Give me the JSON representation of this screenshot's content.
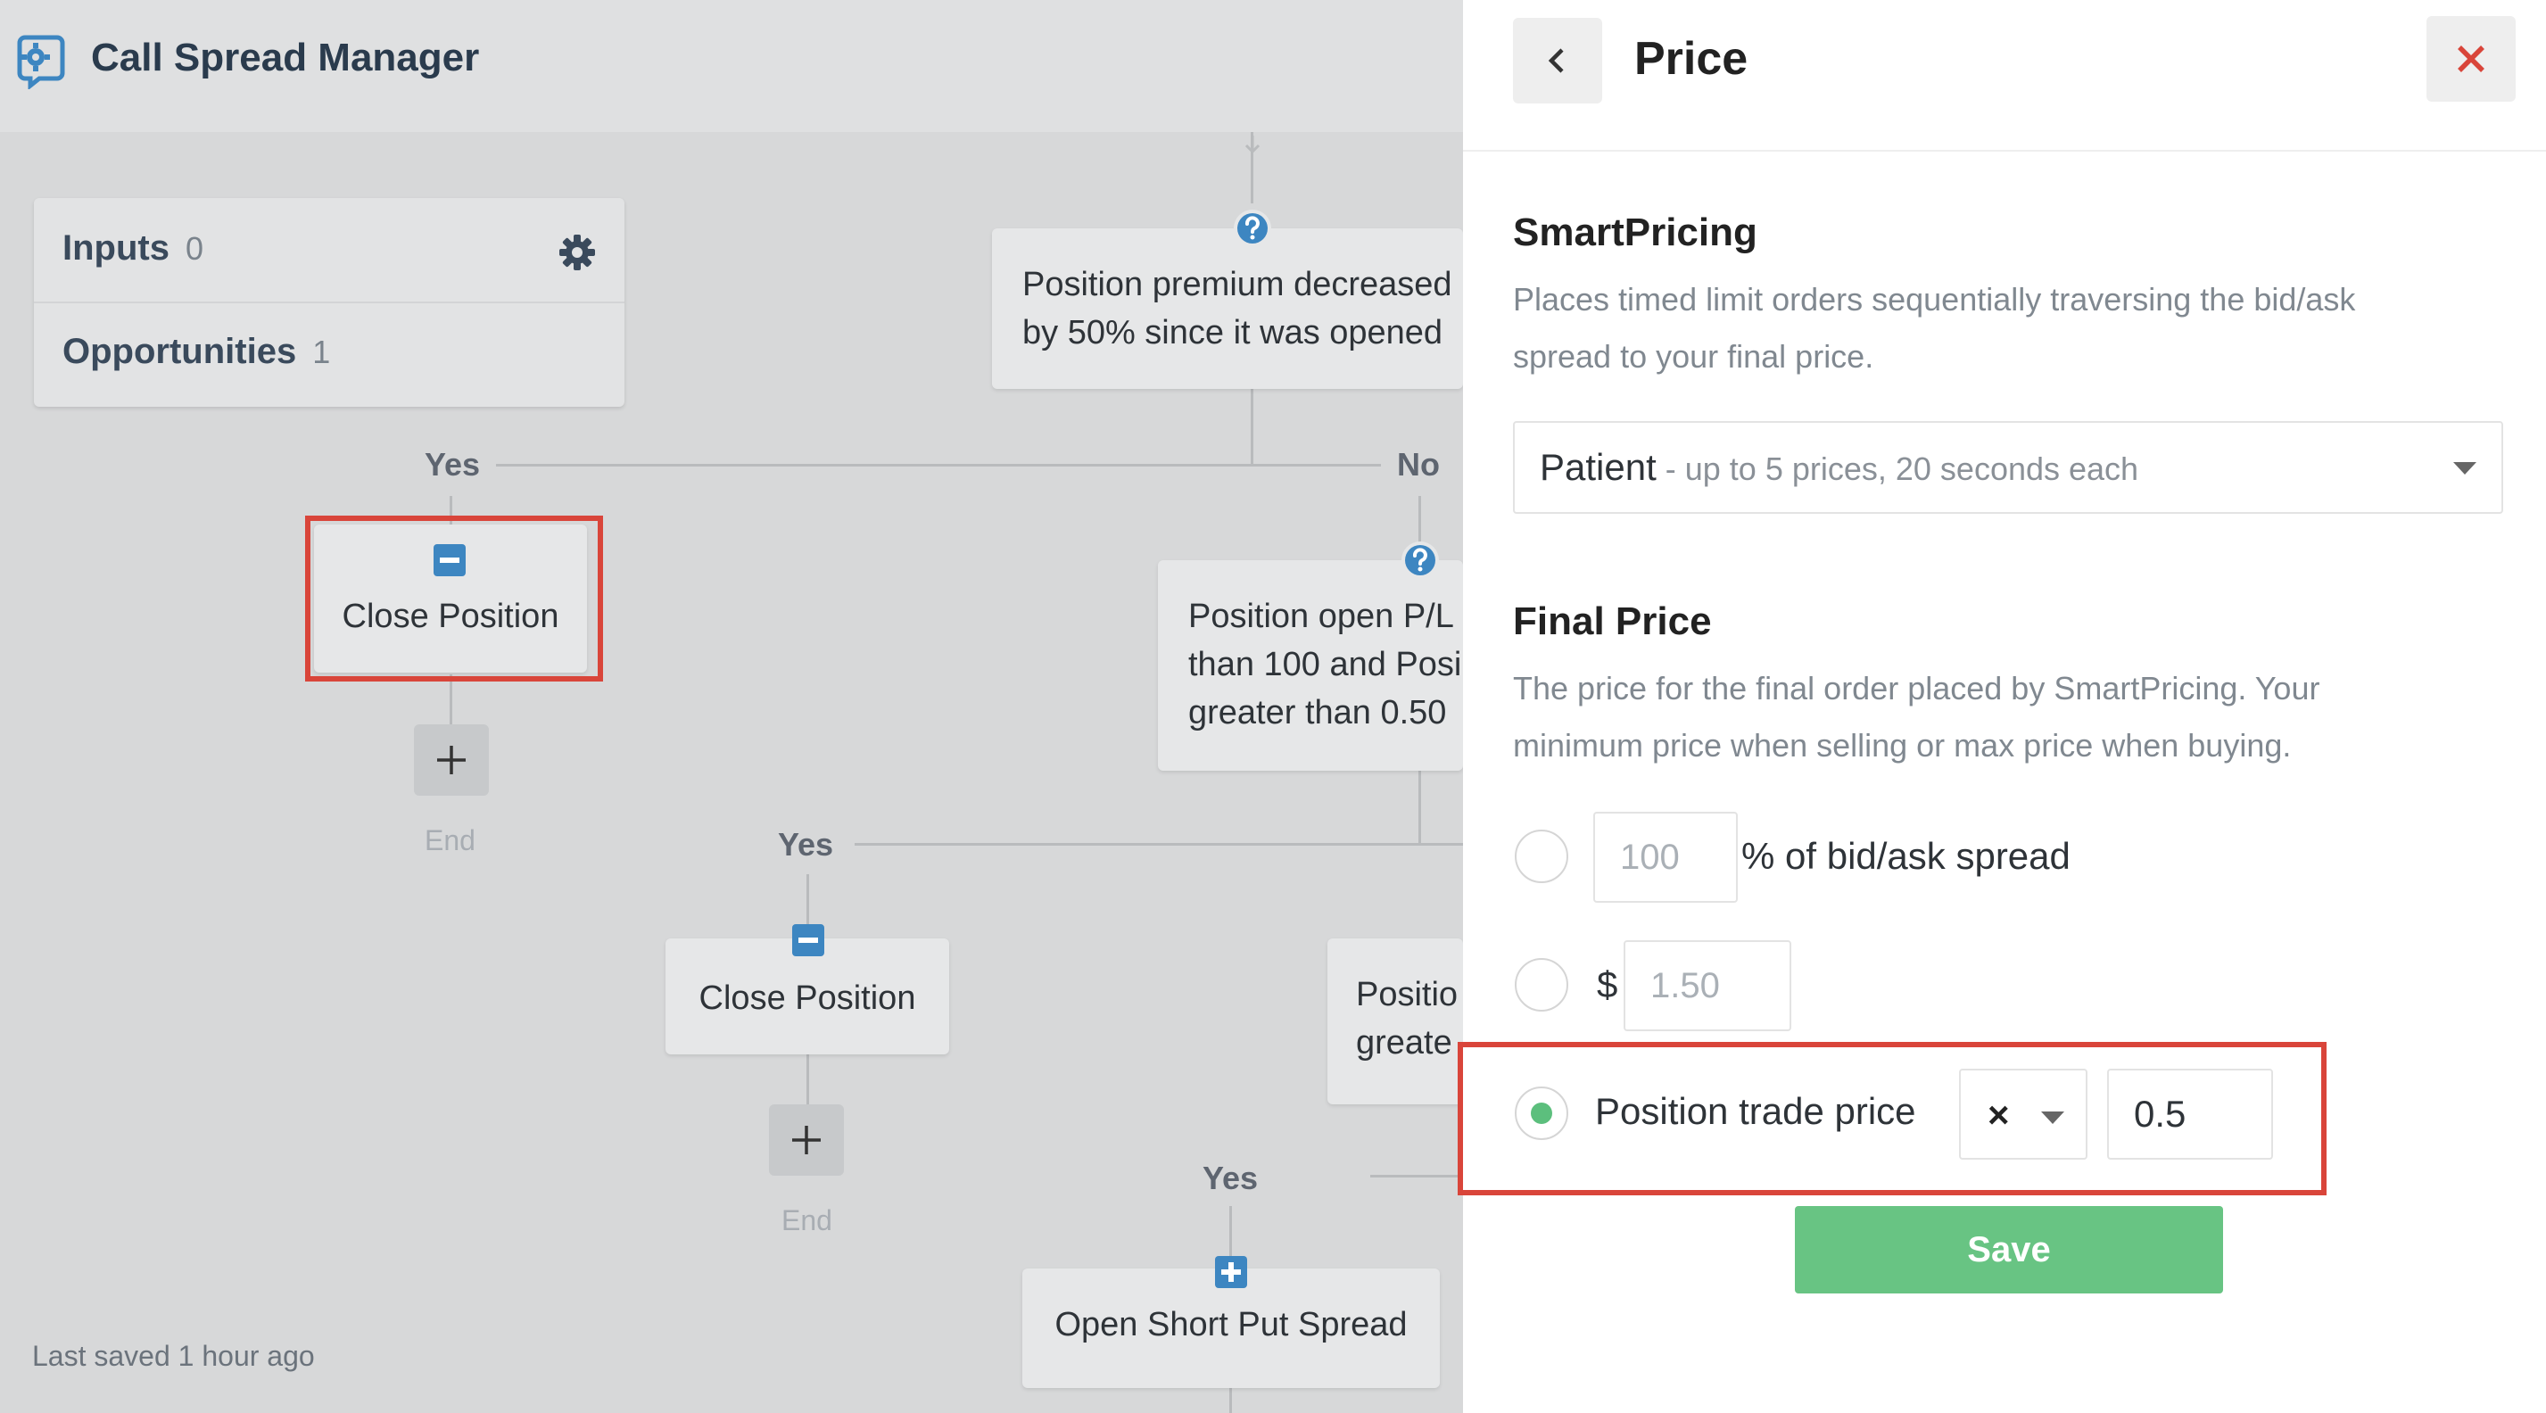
{
  "app": {
    "title": "Call Spread Manager",
    "last_saved": "Last saved 1 hour ago"
  },
  "sidebar": {
    "inputs_label": "Inputs",
    "inputs_count": "0",
    "opportunities_label": "Opportunities",
    "opportunities_count": "1"
  },
  "flow": {
    "condition_1": "Position premium decreased\nby 50% since it was opened",
    "yes_label": "Yes",
    "no_label": "No",
    "close_position_label": "Close Position",
    "end_label": "End",
    "condition_2": "Position open P/L\nthan 100 and Posi\ngreater than 0.50",
    "yes_label_2": "Yes",
    "close_position_label_2": "Close Position",
    "end_label_2": "End",
    "condition_3": "Positio\ngreate",
    "yes_label_3": "Yes",
    "open_spread_label": "Open Short Put Spread"
  },
  "panel": {
    "title": "Price",
    "smart_pricing": {
      "heading": "SmartPricing",
      "description": "Places timed limit orders sequentially traversing the bid/ask\nspread to your final price.",
      "selected_main": "Patient",
      "selected_sub": " - up to 5 prices, 20 seconds each"
    },
    "final_price": {
      "heading": "Final Price",
      "description": "The price for the final order placed by SmartPricing. Your\nminimum price when selling or max price when buying.",
      "option_percent": {
        "value": "100",
        "suffix": "% of bid/ask spread"
      },
      "option_dollar": {
        "prefix": "$",
        "value": "1.50"
      },
      "option_trade": {
        "label": "Position trade price",
        "operator": "×",
        "value": "0.5"
      }
    },
    "save_label": "Save"
  },
  "colors": {
    "highlight": "#d9453a",
    "accent_blue": "#3d86c1",
    "save_green": "#68c483",
    "radio_selected": "#5cbf7d"
  }
}
